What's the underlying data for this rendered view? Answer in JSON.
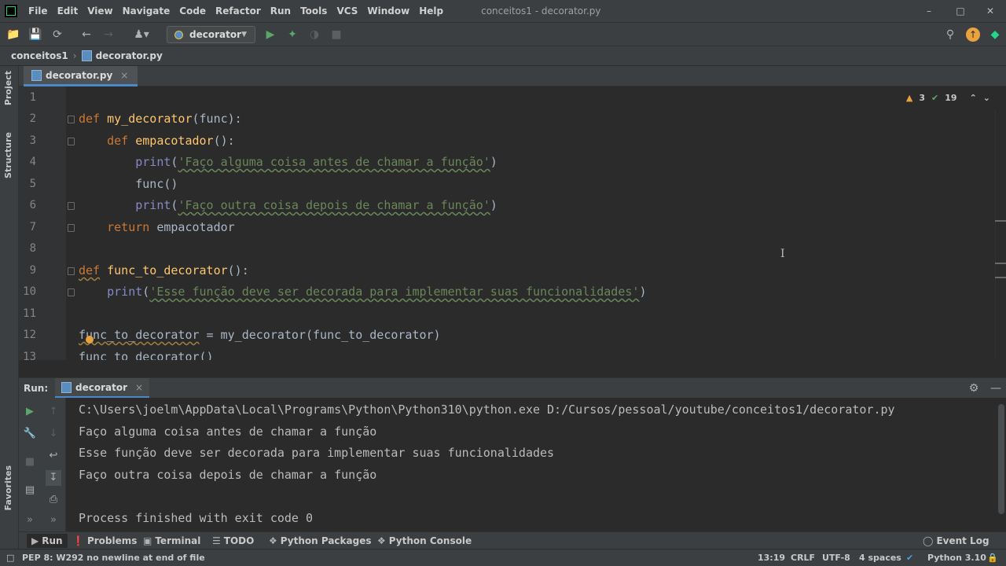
{
  "menubar": {
    "items": [
      "File",
      "Edit",
      "View",
      "Navigate",
      "Code",
      "Refactor",
      "Run",
      "Tools",
      "VCS",
      "Window",
      "Help"
    ],
    "title": "conceitos1 - decorator.py"
  },
  "toolbar": {
    "run_config": "decorator"
  },
  "breadcrumb": {
    "project": "conceitos1",
    "file": "decorator.py"
  },
  "left_strip": {
    "project": "Project",
    "structure": "Structure",
    "favorites": "Favorites"
  },
  "editor": {
    "tab_label": "decorator.py",
    "tab_close": "×",
    "warnings": "3",
    "weak_warnings": "19",
    "line_numbers": [
      "1",
      "2",
      "3",
      "4",
      "5",
      "6",
      "7",
      "8",
      "9",
      "10",
      "11",
      "12",
      "13"
    ],
    "text_cursor": "I"
  },
  "run": {
    "label": "Run:",
    "tab_label": "decorator",
    "tab_close": "×",
    "output": [
      "C:\\Users\\joelm\\AppData\\Local\\Programs\\Python\\Python310\\python.exe D:/Cursos/pessoal/youtube/conceitos1/decorator.py",
      "Faço alguma coisa antes de chamar a função",
      "Esse função deve ser decorada para implementar suas funcionalidades",
      "Faço outra coisa depois de chamar a função",
      "",
      "Process finished with exit code 0"
    ]
  },
  "bottom_tabs": {
    "run": "Run",
    "problems": "Problems",
    "terminal": "Terminal",
    "todo": "TODO",
    "python_packages": "Python Packages",
    "python_console": "Python Console",
    "event_log": "Event Log"
  },
  "statusbar": {
    "message": "PEP 8: W292 no newline at end of file",
    "position": "13:19",
    "line_sep": "CRLF",
    "encoding": "UTF-8",
    "indent": "4 spaces",
    "interpreter": "Python 3.10"
  },
  "colors": {
    "keyword": "#cc7832",
    "function_def": "#ffc66d",
    "string": "#6a8759",
    "builtin": "#8888c6",
    "accent": "#4a88c7"
  }
}
